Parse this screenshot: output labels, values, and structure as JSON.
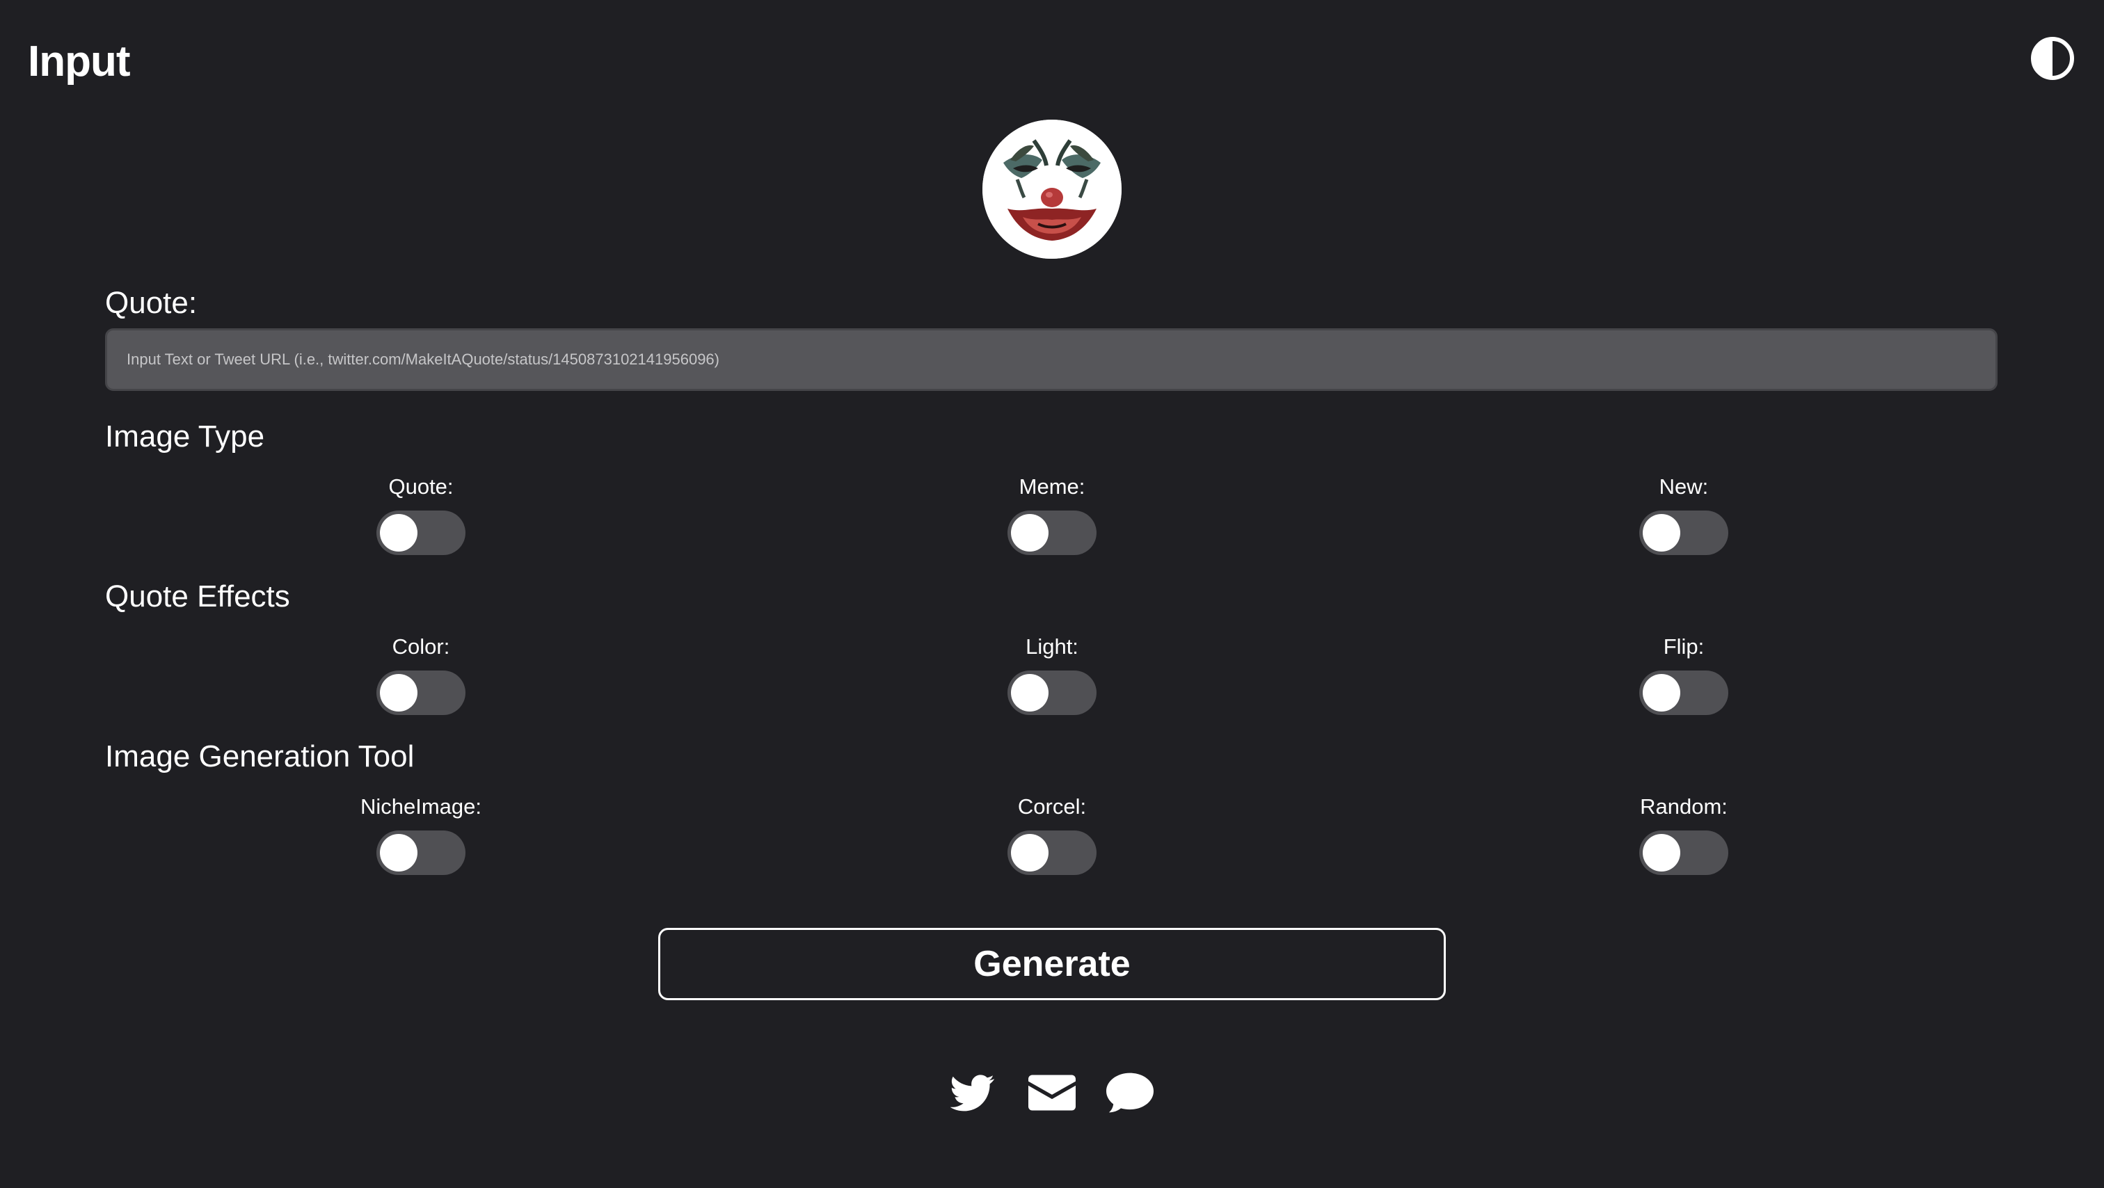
{
  "header": {
    "title": "Input"
  },
  "quote": {
    "label": "Quote:",
    "placeholder": "Input Text or Tweet URL (i.e., twitter.com/MakeItAQuote/status/1450873102141956096)",
    "value": ""
  },
  "sections": {
    "image_type": {
      "title": "Image Type",
      "options": [
        {
          "label": "Quote:",
          "on": false
        },
        {
          "label": "Meme:",
          "on": false
        },
        {
          "label": "New:",
          "on": false
        }
      ]
    },
    "quote_effects": {
      "title": "Quote Effects",
      "options": [
        {
          "label": "Color:",
          "on": false
        },
        {
          "label": "Light:",
          "on": false
        },
        {
          "label": "Flip:",
          "on": false
        }
      ]
    },
    "image_generation_tool": {
      "title": "Image Generation Tool",
      "options": [
        {
          "label": "NicheImage:",
          "on": false
        },
        {
          "label": "Corcel:",
          "on": false
        },
        {
          "label": "Random:",
          "on": false
        }
      ]
    }
  },
  "generate": {
    "label": "Generate"
  },
  "icons": {
    "theme_toggle": "contrast-icon",
    "avatar": "joker-face-logo",
    "social": [
      "twitter-icon",
      "envelope-icon",
      "chat-bubble-icon"
    ]
  },
  "colors": {
    "background": "#1f1f23",
    "input_background": "#56565a",
    "switch_track": "#505054",
    "text": "#ffffff"
  }
}
